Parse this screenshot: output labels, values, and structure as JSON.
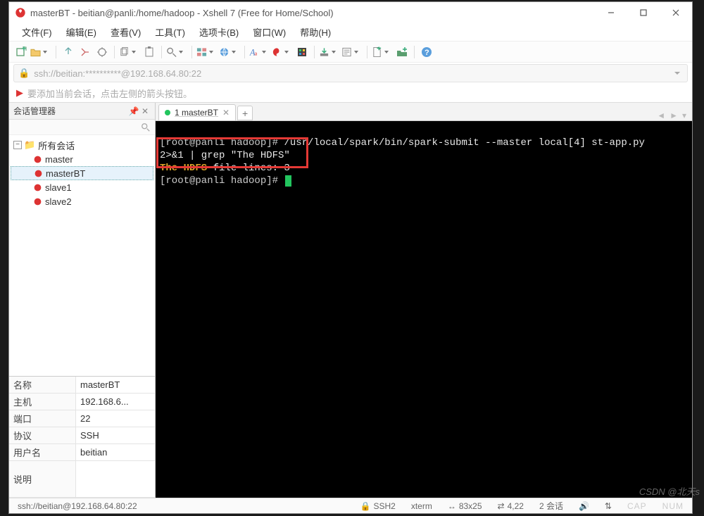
{
  "title": "masterBT - beitian@panli:/home/hadoop - Xshell 7 (Free for Home/School)",
  "menubar": [
    "文件(F)",
    "编辑(E)",
    "查看(V)",
    "工具(T)",
    "选项卡(B)",
    "窗口(W)",
    "帮助(H)"
  ],
  "addressbar": "ssh://beitian:**********@192.168.64.80:22",
  "hint": "要添加当前会话，点击左侧的箭头按钮。",
  "panel": {
    "title": "会话管理器",
    "root": "所有会话",
    "sessions": [
      "master",
      "masterBT",
      "slave1",
      "slave2"
    ],
    "selected": "masterBT"
  },
  "props": [
    {
      "k": "名称",
      "v": "masterBT"
    },
    {
      "k": "主机",
      "v": "192.168.6..."
    },
    {
      "k": "端口",
      "v": "22"
    },
    {
      "k": "协议",
      "v": "SSH"
    },
    {
      "k": "用户名",
      "v": "beitian"
    },
    {
      "k": "说明",
      "v": ""
    }
  ],
  "tabs": [
    {
      "label": "1 masterBT"
    }
  ],
  "terminal": {
    "line1_prompt": "[root@panli hadoop]# ",
    "line1_cmd": "/usr/local/spark/bin/spark-submit --master local[4] st-app.py",
    "line2": "2>&1 | grep \"The HDFS\"",
    "line3_a": "The HDFS",
    "line3_b": " file lines: 3",
    "line4": "[root@panli hadoop]# "
  },
  "status": {
    "conn": "ssh://beitian@192.168.64.80:22",
    "proto": "SSH2",
    "term": "xterm",
    "size": "83x25",
    "pos": "4,22",
    "sessions": "2 会话",
    "cap": "CAP",
    "num": "NUM"
  },
  "watermark": "CSDN @北天s"
}
